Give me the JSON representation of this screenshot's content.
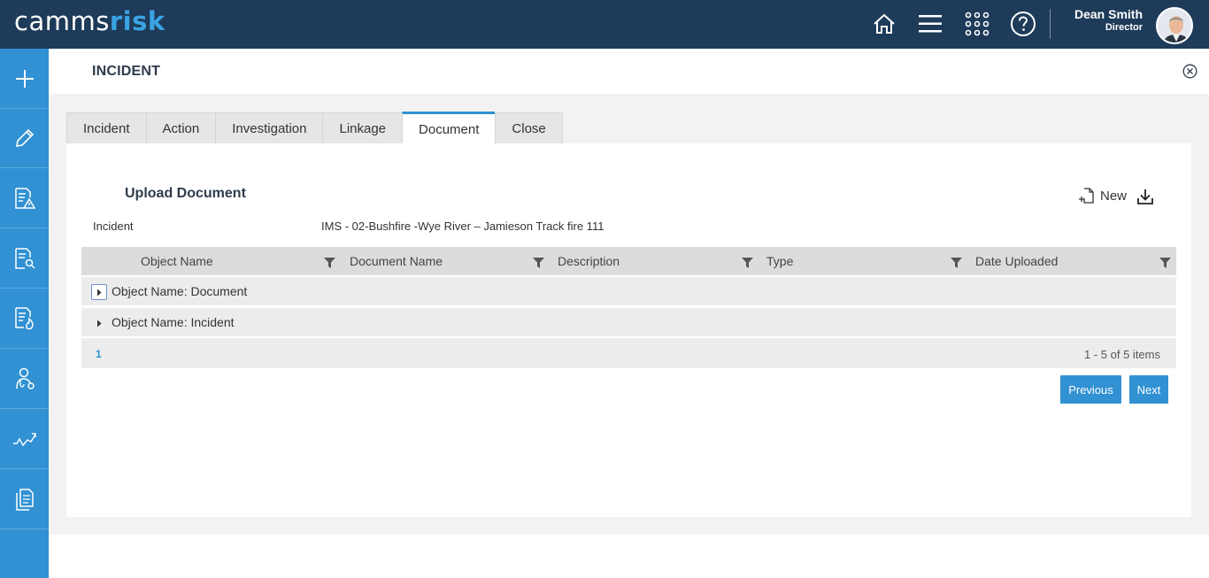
{
  "brand": {
    "part1": "camms",
    "part2": "risk"
  },
  "topbar": {
    "icons": [
      "home-icon",
      "menu-icon",
      "apps-grid-icon",
      "help-icon"
    ],
    "user": {
      "name": "Dean Smith",
      "role": "Director"
    }
  },
  "sidenav": {
    "items": [
      "plus-icon",
      "pencil-icon",
      "document-warning-icon",
      "document-search-icon",
      "document-fire-icon",
      "person-stethoscope-icon",
      "trend-chart-icon",
      "documents-icon"
    ]
  },
  "page": {
    "title": "INCIDENT"
  },
  "tabs": [
    {
      "label": "Incident",
      "active": false
    },
    {
      "label": "Action",
      "active": false
    },
    {
      "label": "Investigation",
      "active": false
    },
    {
      "label": "Linkage",
      "active": false
    },
    {
      "label": "Document",
      "active": true
    },
    {
      "label": "Close",
      "active": false
    }
  ],
  "section": {
    "title": "Upload Document",
    "new_label": "New"
  },
  "field": {
    "label": "Incident",
    "value": "IMS - 02-Bushfire -Wye River – Jamieson Track fire 111"
  },
  "grid": {
    "columns": [
      "Object Name",
      "Document Name",
      "Description",
      "Type",
      "Date Uploaded"
    ],
    "groups": [
      "Object Name: Document",
      "Object Name: Incident"
    ],
    "pager": {
      "page": "1",
      "info": "1 - 5 of 5 items"
    }
  },
  "buttons": {
    "previous": "Previous",
    "next": "Next"
  },
  "colors": {
    "topbar": "#1e3b59",
    "nav": "#3191d3",
    "accent": "#3191d3"
  }
}
